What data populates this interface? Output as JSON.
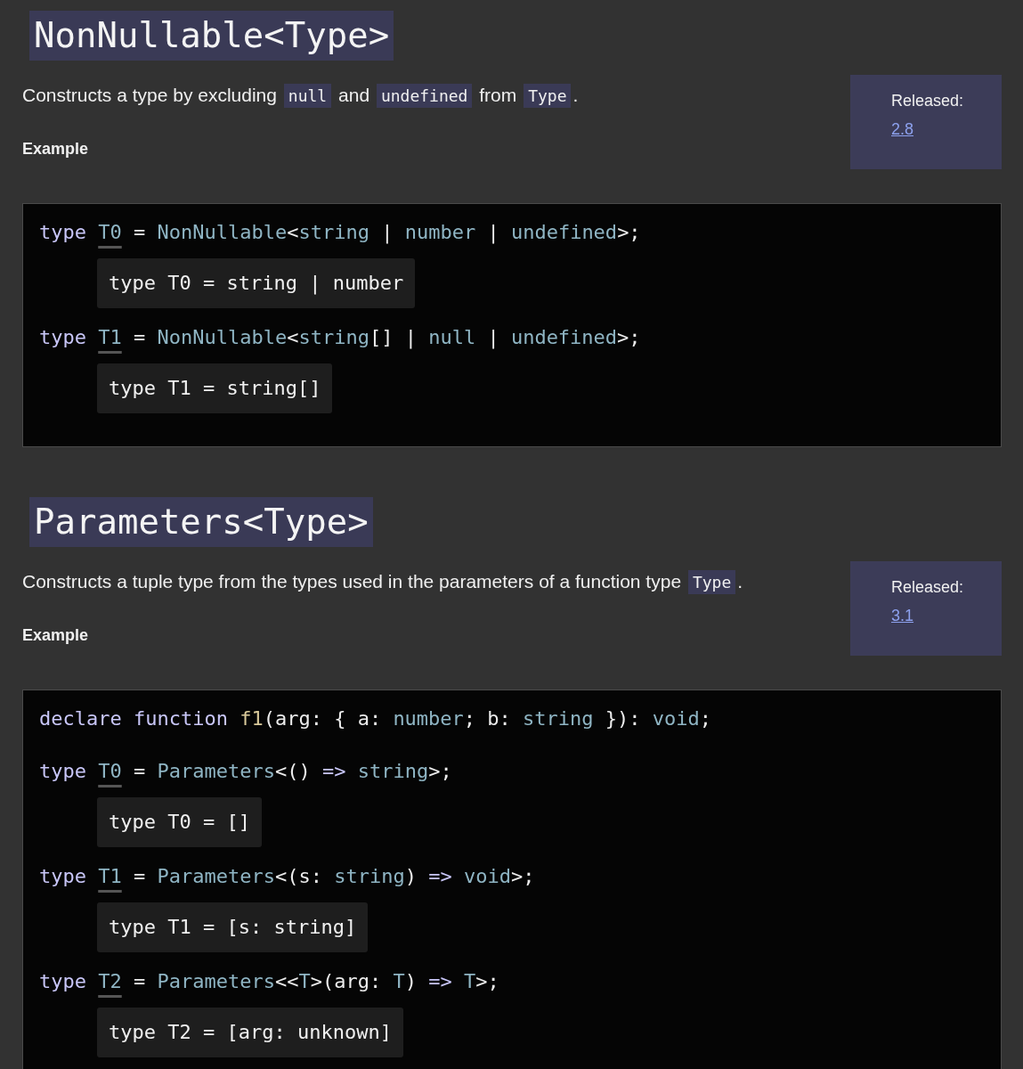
{
  "sections": [
    {
      "title": "NonNullable<Type>",
      "description": [
        {
          "kind": "text",
          "text": "Constructs a type by excluding "
        },
        {
          "kind": "code",
          "text": "null"
        },
        {
          "kind": "text",
          "text": " and "
        },
        {
          "kind": "code",
          "text": "undefined"
        },
        {
          "kind": "text",
          "text": " from "
        },
        {
          "kind": "code",
          "text": "Type"
        },
        {
          "kind": "text",
          "text": "."
        }
      ],
      "example_label": "Example",
      "released": {
        "label": "Released:",
        "version": "2.8"
      },
      "code": [
        {
          "kind": "code",
          "tokens": [
            {
              "kind": "keyword",
              "text": "type "
            },
            {
              "kind": "ident",
              "text": "T0"
            },
            {
              "kind": "plain",
              "text": " = "
            },
            {
              "kind": "type",
              "text": "NonNullable"
            },
            {
              "kind": "plain",
              "text": "<"
            },
            {
              "kind": "type",
              "text": "string"
            },
            {
              "kind": "plain",
              "text": " | "
            },
            {
              "kind": "type",
              "text": "number"
            },
            {
              "kind": "plain",
              "text": " | "
            },
            {
              "kind": "type",
              "text": "undefined"
            },
            {
              "kind": "plain",
              "text": ">;"
            }
          ]
        },
        {
          "kind": "popup",
          "text": "type T0 = string | number"
        },
        {
          "kind": "code",
          "tokens": [
            {
              "kind": "keyword",
              "text": "type "
            },
            {
              "kind": "ident",
              "text": "T1"
            },
            {
              "kind": "plain",
              "text": " = "
            },
            {
              "kind": "type",
              "text": "NonNullable"
            },
            {
              "kind": "plain",
              "text": "<"
            },
            {
              "kind": "type",
              "text": "string"
            },
            {
              "kind": "plain",
              "text": "[] | "
            },
            {
              "kind": "type",
              "text": "null"
            },
            {
              "kind": "plain",
              "text": " | "
            },
            {
              "kind": "type",
              "text": "undefined"
            },
            {
              "kind": "plain",
              "text": ">;"
            }
          ]
        },
        {
          "kind": "popup",
          "text": "type T1 = string[]"
        }
      ]
    },
    {
      "title": "Parameters<Type>",
      "description": [
        {
          "kind": "text",
          "text": "Constructs a tuple type from the types used in the parameters of a function type "
        },
        {
          "kind": "code",
          "text": "Type"
        },
        {
          "kind": "text",
          "text": "."
        }
      ],
      "example_label": "Example",
      "released": {
        "label": "Released:",
        "version": "3.1"
      },
      "code": [
        {
          "kind": "code",
          "tokens": [
            {
              "kind": "keyword",
              "text": "declare function "
            },
            {
              "kind": "func",
              "text": "f1"
            },
            {
              "kind": "plain",
              "text": "(arg: { a: "
            },
            {
              "kind": "type",
              "text": "number"
            },
            {
              "kind": "plain",
              "text": "; b: "
            },
            {
              "kind": "type",
              "text": "string"
            },
            {
              "kind": "plain",
              "text": " }): "
            },
            {
              "kind": "type",
              "text": "void"
            },
            {
              "kind": "plain",
              "text": ";"
            }
          ]
        },
        {
          "kind": "code",
          "tokens": [
            {
              "kind": "keyword",
              "text": "type "
            },
            {
              "kind": "ident",
              "text": "T0"
            },
            {
              "kind": "plain",
              "text": " = "
            },
            {
              "kind": "type",
              "text": "Parameters"
            },
            {
              "kind": "plain",
              "text": "<() "
            },
            {
              "kind": "keyword",
              "text": "=> "
            },
            {
              "kind": "type",
              "text": "string"
            },
            {
              "kind": "plain",
              "text": ">;"
            }
          ]
        },
        {
          "kind": "popup",
          "text": "type T0 = []"
        },
        {
          "kind": "code",
          "tokens": [
            {
              "kind": "keyword",
              "text": "type "
            },
            {
              "kind": "ident",
              "text": "T1"
            },
            {
              "kind": "plain",
              "text": " = "
            },
            {
              "kind": "type",
              "text": "Parameters"
            },
            {
              "kind": "plain",
              "text": "<(s: "
            },
            {
              "kind": "type",
              "text": "string"
            },
            {
              "kind": "plain",
              "text": ") "
            },
            {
              "kind": "keyword",
              "text": "=> "
            },
            {
              "kind": "type",
              "text": "void"
            },
            {
              "kind": "plain",
              "text": ">;"
            }
          ]
        },
        {
          "kind": "popup",
          "text": "type T1 = [s: string]"
        },
        {
          "kind": "code",
          "tokens": [
            {
              "kind": "keyword",
              "text": "type "
            },
            {
              "kind": "ident",
              "text": "T2"
            },
            {
              "kind": "plain",
              "text": " = "
            },
            {
              "kind": "type",
              "text": "Parameters"
            },
            {
              "kind": "plain",
              "text": "<<"
            },
            {
              "kind": "type",
              "text": "T"
            },
            {
              "kind": "plain",
              "text": ">(arg: "
            },
            {
              "kind": "type",
              "text": "T"
            },
            {
              "kind": "plain",
              "text": ") "
            },
            {
              "kind": "keyword",
              "text": "=> "
            },
            {
              "kind": "type",
              "text": "T"
            },
            {
              "kind": "plain",
              "text": ">;"
            }
          ]
        },
        {
          "kind": "popup",
          "text": "type T2 = [arg: unknown]"
        }
      ]
    }
  ]
}
